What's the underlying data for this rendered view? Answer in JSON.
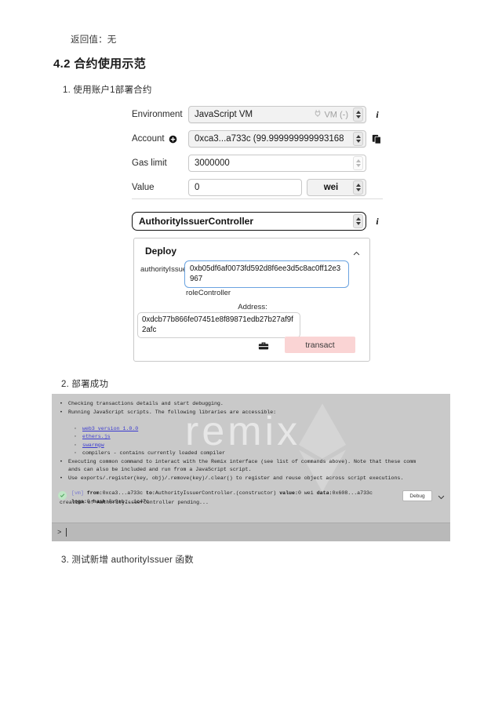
{
  "document": {
    "return_value_line": "返回值：无",
    "heading": "4.2 合约使用示范",
    "item1": "1. 使用账户1部署合约",
    "item2": "2. 部署成功",
    "item3": "3. 测试新增 authorityIssuer 函数"
  },
  "deploy_form": {
    "environment": {
      "label": "Environment",
      "value": "JavaScript VM",
      "status": "VM (-)"
    },
    "account": {
      "label": "Account",
      "value": "0xca3...a733c (99.999999999993168"
    },
    "gas_limit": {
      "label": "Gas limit",
      "value": "3000000"
    },
    "value": {
      "label": "Value",
      "value": "0",
      "unit": "wei"
    },
    "contract": {
      "value": "AuthorityIssuerController"
    }
  },
  "deploy_card": {
    "title": "Deploy",
    "param1_label": "authorityIssuerDataAddress:",
    "param1_value": "0xb05df6af0073fd592d8f6ee3d5c8ac0ff12e3967",
    "param2_label": "roleController",
    "param2_sublabel": "Address:",
    "param2_value": "0xdcb77b866fe07451e8f89871edb27b27af9f2afc",
    "transact_label": "transact"
  },
  "terminal": {
    "lines": [
      "Checking transactions details and start debugging.",
      "Running JavaScript scripts. The following libraries are accessible:"
    ],
    "libraries": [
      {
        "text": "web3 version 1.0.0",
        "link": true
      },
      {
        "text": "ethers.js",
        "link": true
      },
      {
        "text": "swarmgw",
        "link": true
      },
      {
        "text": "compilers - contains currently loaded compiler",
        "link": false
      }
    ],
    "lines2": [
      "Executing common command to interact with the Remix interface (see list of commands above). Note that these comm",
      "ands can also be included and run from a JavaScript script.",
      "Use exports/.register(key, obj)/.remove(key)/.clear() to register and reuse object across script executions."
    ],
    "pending": "creation of AuthorityIssuerController pending...",
    "watermark": "remix",
    "transaction": {
      "badge": "[vm]",
      "from_label": "from:",
      "from_value": "0xca3...a733c",
      "to_label": "to:",
      "to_value": "AuthorityIssuerController.(constructor)",
      "value_label": "value:",
      "value_value": "0 wei",
      "data_label": "data:",
      "data_value": "0x608...a733c",
      "logs_label": "logs:",
      "logs_value": "0",
      "hash_label": "hash:",
      "hash_value": "0x9ab...1c47c"
    },
    "debug_label": "Debug",
    "prompt": ">"
  }
}
